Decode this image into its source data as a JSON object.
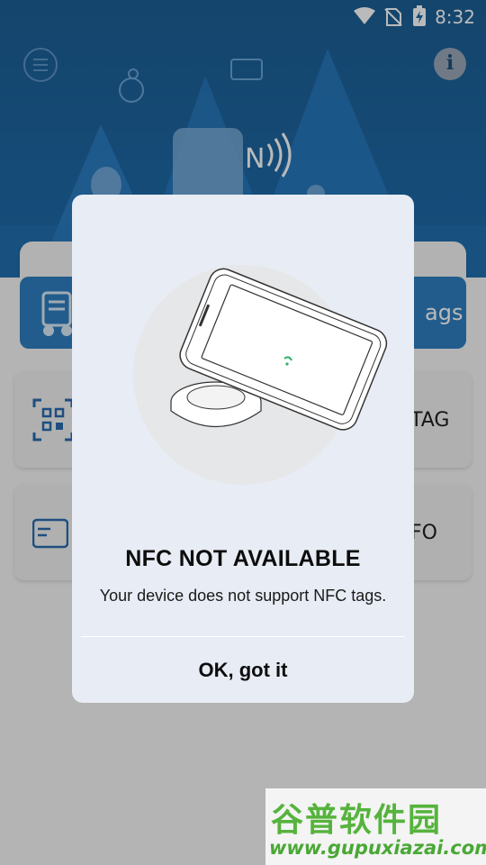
{
  "status_bar": {
    "time": "8:32"
  },
  "background": {
    "menu_icon": "menu-icon",
    "info_icon": "info-icon",
    "blue_button_label": "ags",
    "card1_label": "TAG",
    "card2_label": "FO"
  },
  "dialog": {
    "title": "NFC NOT AVAILABLE",
    "message": "Your device does not support NFC tags.",
    "ok_label": "OK, got it"
  },
  "watermark": {
    "chinese": "谷普软件园",
    "url": "www.gupuxiazai.com"
  },
  "colors": {
    "header_blue": "#1d67a3",
    "dialog_bg": "#e8ecf5",
    "accent_blue": "#2f7fc1",
    "watermark_green": "#56b33d"
  }
}
